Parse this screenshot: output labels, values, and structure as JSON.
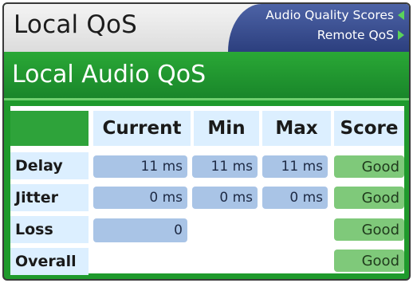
{
  "header": {
    "title": "Local QoS",
    "nav": [
      {
        "label": "Audio Quality Scores",
        "direction": "left"
      },
      {
        "label": "Remote QoS",
        "direction": "right"
      }
    ]
  },
  "section": {
    "title": "Local Audio QoS"
  },
  "table": {
    "columns": [
      "Current",
      "Min",
      "Max",
      "Score"
    ],
    "rows": [
      {
        "label": "Delay",
        "current": "11 ms",
        "min": "11 ms",
        "max": "11 ms",
        "score": "Good"
      },
      {
        "label": "Jitter",
        "current": "0 ms",
        "min": "0 ms",
        "max": "0 ms",
        "score": "Good"
      },
      {
        "label": "Loss",
        "current": "0",
        "min": "",
        "max": "",
        "score": "Good"
      },
      {
        "label": "Overall",
        "current": "",
        "min": "",
        "max": "",
        "score": "Good"
      }
    ]
  },
  "colors": {
    "header_bg": "#dcdcdc",
    "nav_bg": "#3a4f92",
    "section_bg": "#1f9a2c",
    "label_bg": "#dcefff",
    "value_bg": "#a9c4e6",
    "score_bg": "#7fc97a",
    "arrow": "#5ad35a"
  }
}
